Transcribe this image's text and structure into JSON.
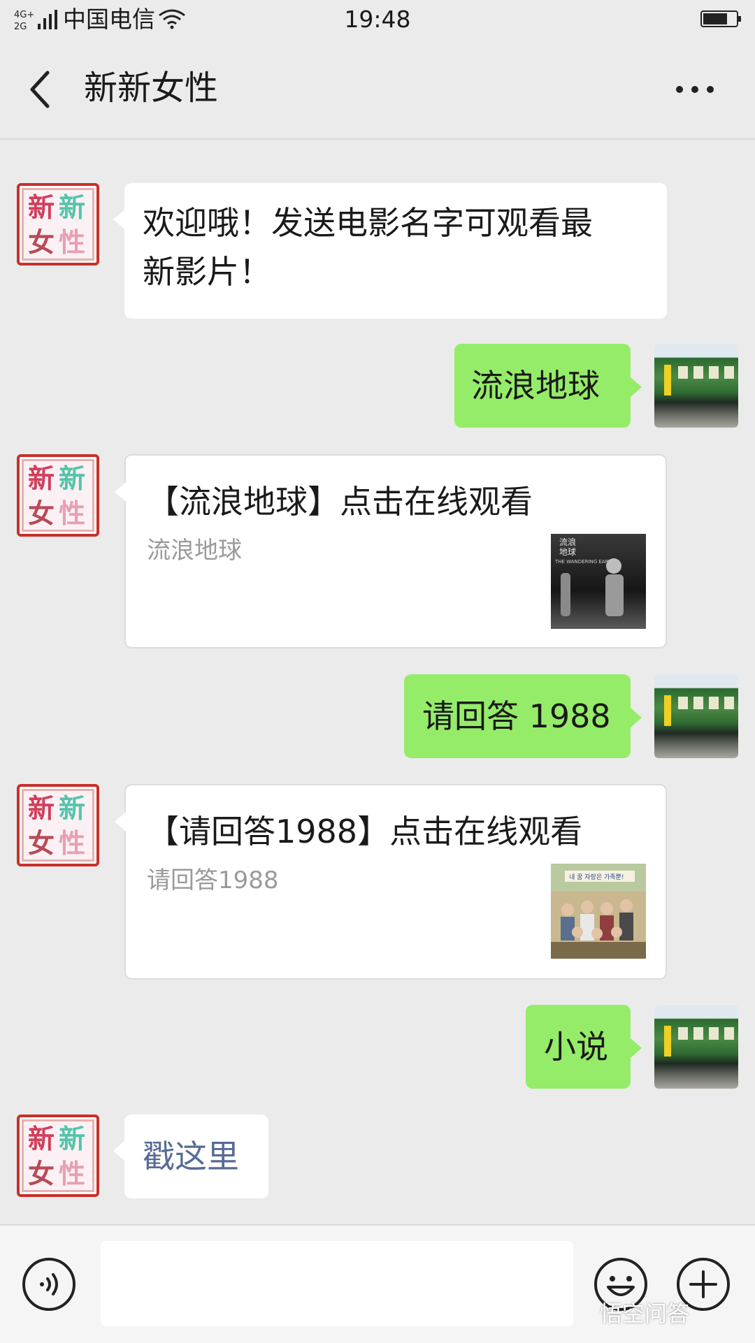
{
  "status_bar": {
    "network": "4G+ 2G",
    "carrier": "中国电信",
    "time": "19:48"
  },
  "header": {
    "title": "新新女性"
  },
  "bot_avatar": {
    "chars": [
      "新",
      "新",
      "女",
      "性"
    ],
    "colors": [
      "#d23d5b",
      "#54c4a9",
      "#b84a56",
      "#e7a0b3"
    ]
  },
  "messages": [
    {
      "from": "bot",
      "type": "text",
      "lines": [
        "欢迎哦！发送电影名字可观看最",
        "新影片！"
      ]
    },
    {
      "from": "user",
      "type": "text",
      "text": "流浪地球"
    },
    {
      "from": "bot",
      "type": "card",
      "title": "【流浪地球】点击在线观看",
      "desc": "流浪地球"
    },
    {
      "from": "user",
      "type": "text",
      "text": "请回答 1988"
    },
    {
      "from": "bot",
      "type": "card",
      "title": "【请回答1988】点击在线观看",
      "desc": "请回答1988"
    },
    {
      "from": "user",
      "type": "text",
      "text": "小说"
    },
    {
      "from": "bot",
      "type": "link",
      "text": "戳这里"
    }
  ],
  "thumbnails": {
    "card1_lines": [
      "流浪",
      "地球",
      "THE WANDERING EARTH"
    ],
    "card2_caption": "내 꿈 자랑은 가족뿐!"
  },
  "watermark": "悟空问答",
  "colors": {
    "background": "#ebebeb",
    "user_bubble": "#95ec69",
    "bot_bubble": "#ffffff",
    "link": "#576b95"
  }
}
